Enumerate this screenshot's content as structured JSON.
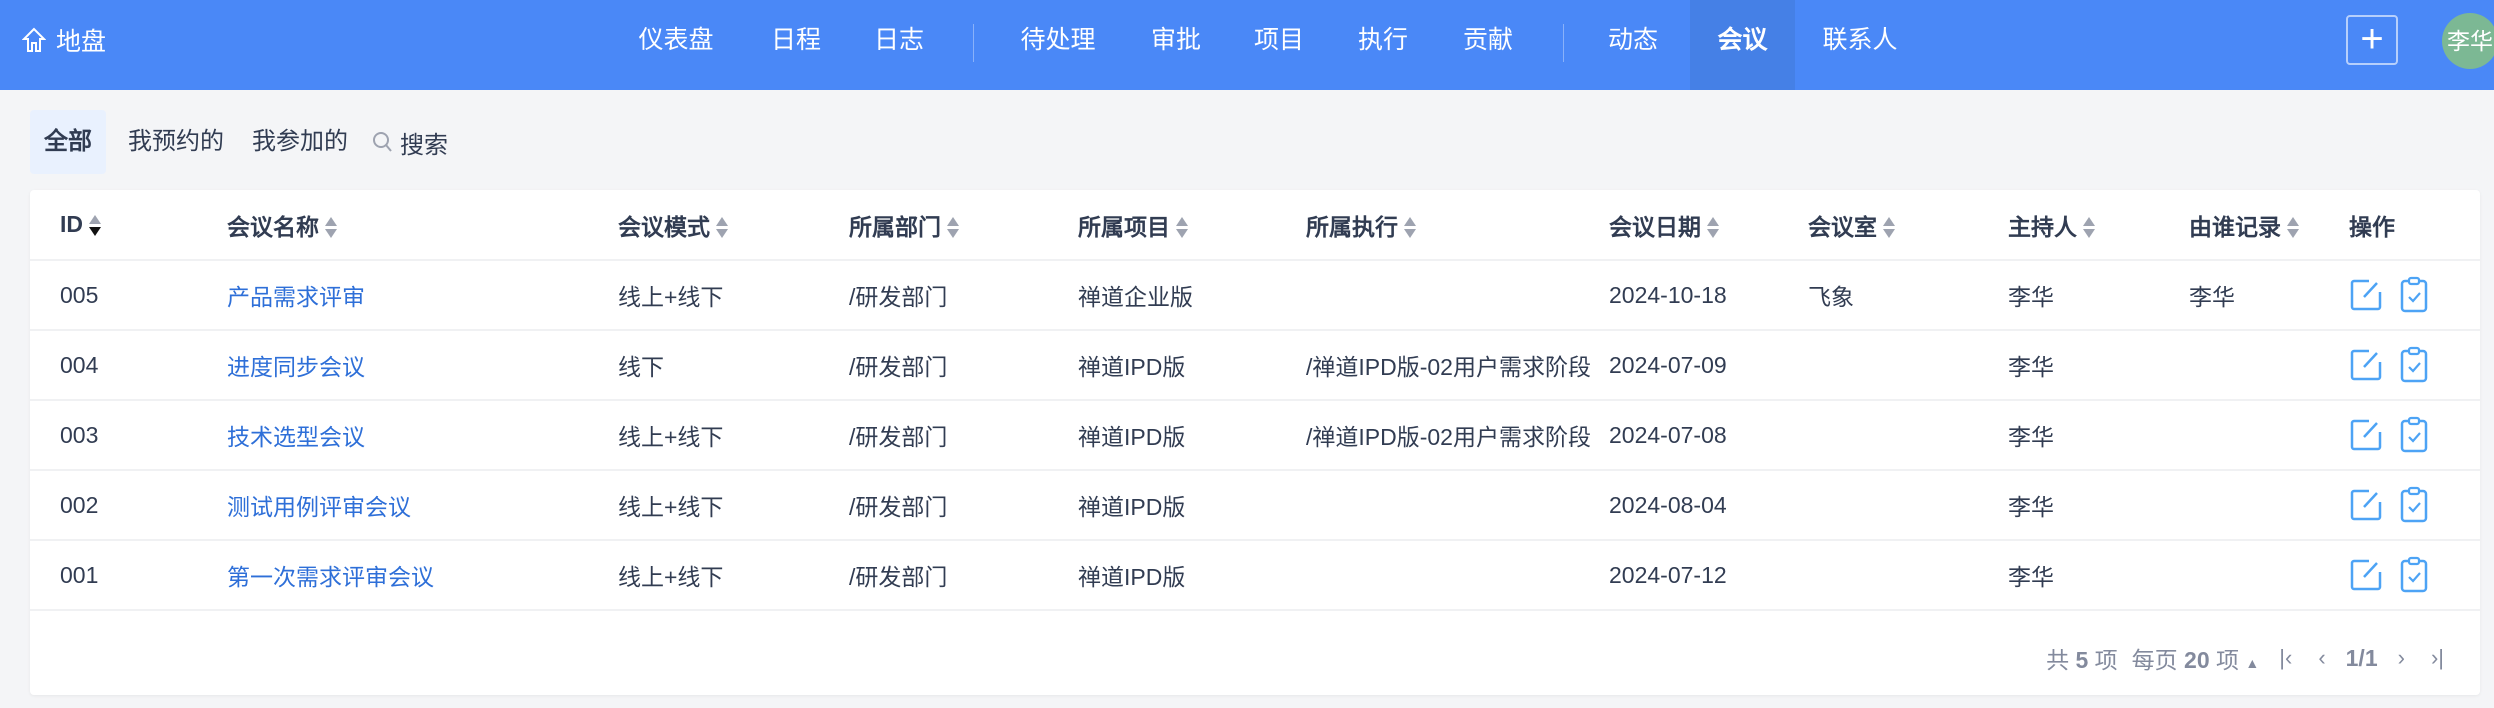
{
  "nav": {
    "brand": "地盘",
    "items": [
      "仪表盘",
      "日程",
      "日志",
      "待处理",
      "审批",
      "项目",
      "执行",
      "贡献",
      "动态",
      "会议",
      "联系人"
    ],
    "active": "会议",
    "avatar": "李华",
    "add_icon": "plus-icon"
  },
  "tabs": {
    "items": [
      "全部",
      "我预约的",
      "我参加的"
    ],
    "search": "搜索"
  },
  "table": {
    "headers": [
      "ID",
      "会议名称",
      "会议模式",
      "所属部门",
      "所属项目",
      "所属执行",
      "会议日期",
      "会议室",
      "主持人",
      "由谁记录",
      "操作"
    ],
    "rows": [
      [
        "005",
        "产品需求评审",
        "线上+线下",
        "/研发部门",
        "禅道企业版",
        "",
        "2024-10-18",
        "飞象",
        "李华",
        "李华"
      ],
      [
        "004",
        "进度同步会议",
        "线下",
        "/研发部门",
        "禅道IPD版",
        "/禅道IPD版-02用户需求阶段",
        "2024-07-09",
        "",
        "李华",
        ""
      ],
      [
        "003",
        "技术选型会议",
        "线上+线下",
        "/研发部门",
        "禅道IPD版",
        "/禅道IPD版-02用户需求阶段",
        "2024-07-08",
        "",
        "李华",
        ""
      ],
      [
        "002",
        "测试用例评审会议",
        "线上+线下",
        "/研发部门",
        "禅道IPD版",
        "",
        "2024-08-04",
        "",
        "李华",
        ""
      ],
      [
        "001",
        "第一次需求评审会议",
        "线上+线下",
        "/研发部门",
        "禅道IPD版",
        "",
        "2024-07-12",
        "",
        "李华",
        ""
      ]
    ]
  },
  "pager": {
    "total_pre": "共",
    "total": "5",
    "total_post": "项",
    "per_pre": "每页",
    "per": "20",
    "per_post": "项",
    "page": "1/1"
  },
  "colors": {
    "nav": "#4a88f7",
    "link": "#2e6fd8",
    "icon": "#4da3f5"
  }
}
